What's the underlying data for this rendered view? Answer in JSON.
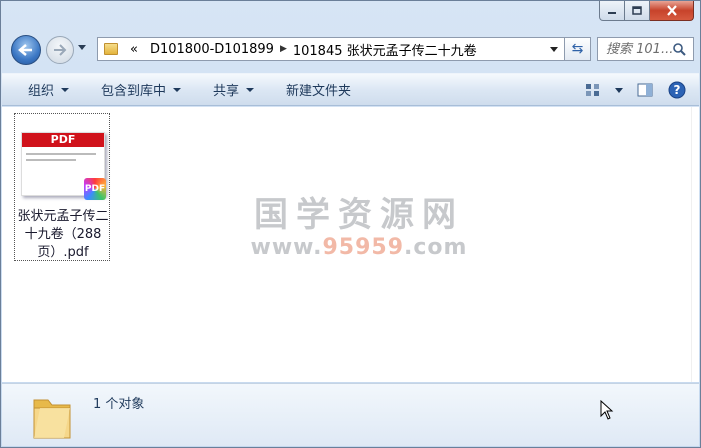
{
  "breadcrumb": {
    "overflow": "«",
    "segments": [
      "D101800-D101899",
      "101845 张状元孟子传二十九卷"
    ]
  },
  "search": {
    "placeholder": "搜索 101..."
  },
  "toolbar": {
    "organize": "组织",
    "include_library": "包含到库中",
    "share": "共享",
    "new_folder": "新建文件夹"
  },
  "file": {
    "thumbnail_label": "PDF",
    "badge_label": "PDF",
    "name": "张状元孟子传二十九卷（288页）.pdf"
  },
  "watermark": {
    "main": "国学资源网",
    "sub_prefix": "www.",
    "sub_number": "95959",
    "sub_suffix": ".com"
  },
  "status": {
    "count_text": "1 个对象"
  },
  "colors": {
    "accent": "#d0121b",
    "chrome": "#c5d8ee",
    "text": "#1e395b"
  }
}
